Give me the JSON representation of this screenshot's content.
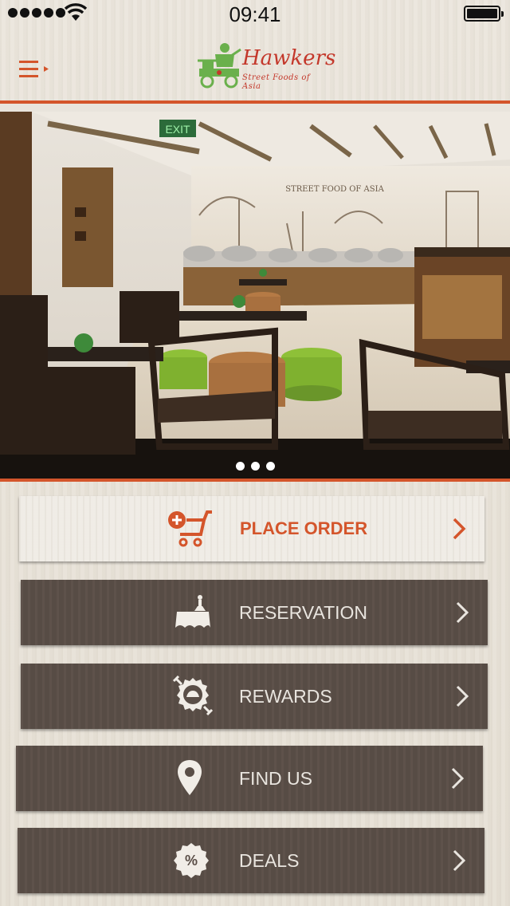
{
  "status_bar": {
    "time": "09:41"
  },
  "header": {
    "logo_title": "Hawkers",
    "logo_tagline": "Street Foods of Asia",
    "menu_icon": "hamburger-menu-icon"
  },
  "hero": {
    "signage_exit": "EXIT",
    "wall_text": "STREET FOOD OF ASIA",
    "carousel_dots": 3
  },
  "menu": {
    "place_order": {
      "label": "PLACE ORDER",
      "icon": "add-to-cart-icon"
    },
    "reservation": {
      "label": "RESERVATION",
      "icon": "reserved-table-icon"
    },
    "rewards": {
      "label": "REWARDS",
      "icon": "rewards-badge-icon"
    },
    "find_us": {
      "label": "FIND US",
      "icon": "location-pin-icon"
    },
    "deals": {
      "label": "DEALS",
      "icon": "percent-badge-icon"
    }
  },
  "colors": {
    "accent": "#d4552b",
    "dark_button": "#5a4e47",
    "light_button": "#efebe4",
    "logo_red": "#c4382b",
    "logo_green": "#6ab04c"
  }
}
